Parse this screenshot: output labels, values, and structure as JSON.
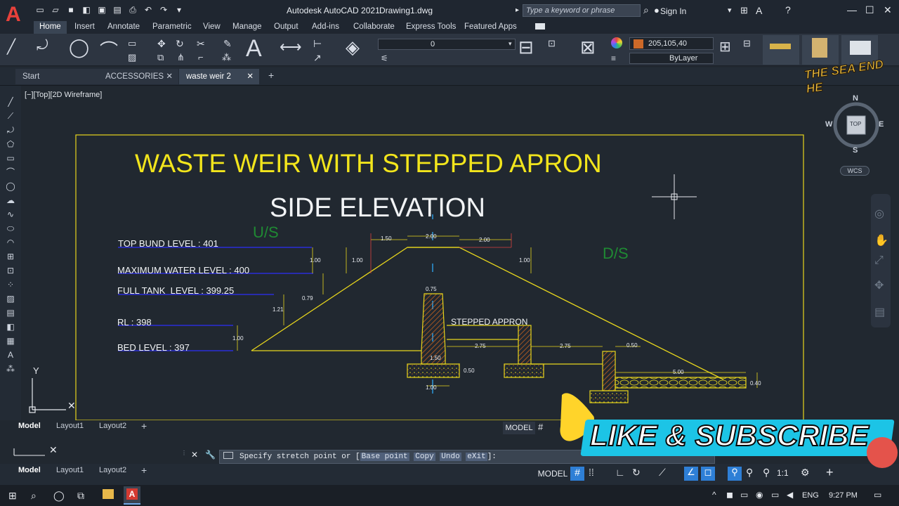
{
  "titlebar": {
    "app_title": "Autodesk AutoCAD 2021",
    "file_name": "Drawing1.dwg",
    "search_placeholder": "Type a keyword or phrase",
    "sign_in": "Sign In"
  },
  "menu": {
    "items": [
      "Home",
      "Insert",
      "Annotate",
      "Parametric",
      "View",
      "Manage",
      "Output",
      "Add-ins",
      "Collaborate",
      "Express Tools",
      "Featured Apps"
    ]
  },
  "ribbon": {
    "layer_value": "0",
    "color_value": "205,105,40",
    "linetype_value": "ByLayer",
    "colors": {
      "current_color": "#cd6928"
    }
  },
  "file_tabs": {
    "start": "Start",
    "tab1": "ACCESSORIES",
    "tab2": "waste weir 2"
  },
  "viewport": {
    "label": "[−][Top][2D Wireframe]",
    "wcs": "WCS",
    "viewcube_top": "TOP",
    "compass": {
      "n": "N",
      "s": "S",
      "e": "E",
      "w": "W"
    }
  },
  "drawing": {
    "title": "WASTE WEIR WITH STEPPED APRON",
    "subtitle": "SIDE ELEVATION",
    "us": "U/S",
    "ds": "D/S",
    "labels": {
      "top_bund": "TOP BUND LEVEL : 401",
      "mwl": "MAXIMUM WATER LEVEL : 400",
      "ftl": "FULL TANK  LEVEL : 399.25",
      "rl": "RL : 398",
      "bed": "BED LEVEL : 397",
      "stepped": "STEPPED APPRON"
    },
    "dims": {
      "d150": "1.50",
      "d200a": "2.00",
      "d200b": "2.00",
      "d100a": "1.00",
      "d100b": "1.00",
      "d100c": "1.00",
      "d079": "0.79",
      "d121": "1.21",
      "d100d": "1.00",
      "d075": "0.75",
      "d275a": "2.75",
      "d275b": "2.75",
      "d050a": "0.50",
      "d050b": "0.50",
      "d150b": "1.50",
      "d100e": "1.00",
      "d500": "5.00",
      "d040": "0.40"
    },
    "colors": {
      "title": "#f2e51c",
      "us_ds": "#1f8a33",
      "frame": "#e8d61c",
      "leader": "#2a2ed8"
    }
  },
  "layouts": {
    "model": "Model",
    "layout1": "Layout1",
    "layout2": "Layout2",
    "model_btn": "MODEL"
  },
  "command": {
    "prompt": "Specify stretch point or [",
    "opt1": "Base point",
    "opt2": "Copy",
    "opt3": "Undo",
    "opt4": "eXit",
    "end": "]:"
  },
  "status": {
    "model": "MODEL",
    "scale": "1:1"
  },
  "overlay": {
    "like": "LIKE & SUBSCRIBE",
    "sea": "THE SEA END HE"
  },
  "taskbar": {
    "lang": "ENG",
    "time": "9:27 PM"
  }
}
